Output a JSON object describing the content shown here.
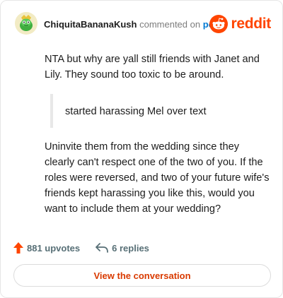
{
  "comment": {
    "author": "ChiquitaBananaKush",
    "action": "commented on",
    "target": "post",
    "paragraph1": "NTA but why are yall still friends with Janet and Lily. They sound too toxic to be around.",
    "quote": "started harassing Mel over text",
    "paragraph2": "Uninvite them from the wedding since they clearly can't respect one of the two of you. If the roles were reversed, and two of your future wife's friends kept harassing you like this, would you want to include them at your wedding?"
  },
  "brand": {
    "name": "reddit",
    "color": "#ff4500"
  },
  "stats": {
    "upvotes": "881 upvotes",
    "replies": "6 replies"
  },
  "cta": {
    "label": "View the conversation"
  },
  "icons": {
    "avatar": "snoo-avatar-icon",
    "brand": "reddit-logo-icon",
    "upvote": "upvote-arrow-icon",
    "reply": "reply-arrow-icon"
  }
}
